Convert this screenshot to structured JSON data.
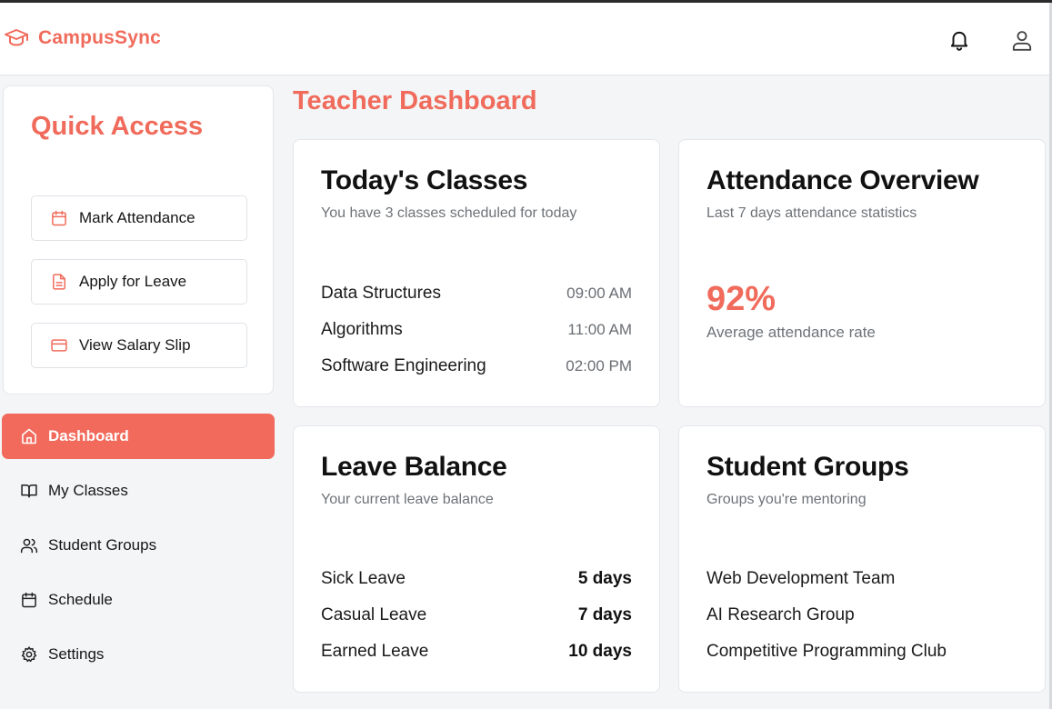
{
  "app": {
    "brand_name": "CampusSync",
    "logo_icon": "graduation-cap-icon",
    "accent_color": "#f06b5b"
  },
  "header": {
    "notification_icon": "bell-icon",
    "profile_icon": "user-icon"
  },
  "quick_access": {
    "title": "Quick Access",
    "buttons": [
      {
        "label": "Mark Attendance",
        "icon": "calendar-icon"
      },
      {
        "label": "Apply for Leave",
        "icon": "file-text-icon"
      },
      {
        "label": "View Salary Slip",
        "icon": "credit-card-icon"
      }
    ]
  },
  "sidebar": {
    "items": [
      {
        "label": "Dashboard",
        "icon": "home-icon",
        "active": true
      },
      {
        "label": "My Classes",
        "icon": "book-open-icon",
        "active": false
      },
      {
        "label": "Student Groups",
        "icon": "users-icon",
        "active": false
      },
      {
        "label": "Schedule",
        "icon": "calendar-icon",
        "active": false
      },
      {
        "label": "Settings",
        "icon": "gear-icon",
        "active": false
      }
    ]
  },
  "main": {
    "page_title": "Teacher Dashboard",
    "todays_classes": {
      "title": "Today's Classes",
      "subtitle": "You have 3 classes scheduled for today",
      "classes": [
        {
          "name": "Data Structures",
          "time": "09:00 AM"
        },
        {
          "name": "Algorithms",
          "time": "11:00 AM"
        },
        {
          "name": "Software Engineering",
          "time": "02:00 PM"
        }
      ]
    },
    "attendance": {
      "title": "Attendance Overview",
      "subtitle": "Last 7 days attendance statistics",
      "rate": "92%",
      "rate_caption": "Average attendance rate"
    },
    "leave_balance": {
      "title": "Leave Balance",
      "subtitle": "Your current leave balance",
      "items": [
        {
          "type": "Sick Leave",
          "days": "5 days"
        },
        {
          "type": "Casual Leave",
          "days": "7 days"
        },
        {
          "type": "Earned Leave",
          "days": "10 days"
        }
      ]
    },
    "student_groups": {
      "title": "Student Groups",
      "subtitle": "Groups you're mentoring",
      "groups": [
        "Web Development Team",
        "AI Research Group",
        "Competitive Programming Club"
      ]
    }
  }
}
